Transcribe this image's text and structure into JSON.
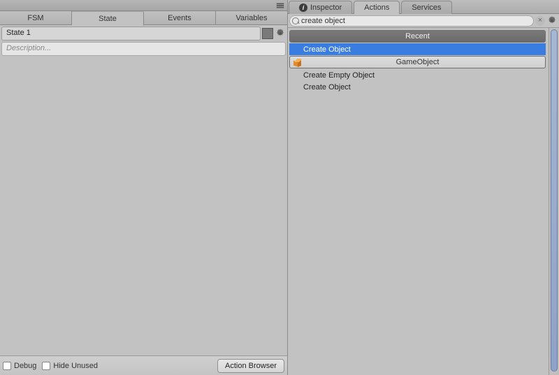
{
  "left": {
    "tabs": [
      "FSM",
      "State",
      "Events",
      "Variables"
    ],
    "active_tab_index": 1,
    "state_name": "State 1",
    "description_placeholder": "Description...",
    "footer": {
      "debug_label": "Debug",
      "hide_unused_label": "Hide Unused",
      "action_browser_label": "Action Browser"
    }
  },
  "right": {
    "tabs": [
      {
        "label": "Inspector",
        "has_info_icon": true
      },
      {
        "label": "Actions",
        "has_info_icon": false
      },
      {
        "label": "Services",
        "has_info_icon": false
      }
    ],
    "active_tab_index": 1,
    "search_value": "create object",
    "groups": [
      {
        "title": "Recent",
        "style": "recent",
        "icon": null,
        "items": [
          {
            "label": "Create Object",
            "selected": true
          }
        ]
      },
      {
        "title": "GameObject",
        "style": "gameobject",
        "icon": "cube-icon",
        "items": [
          {
            "label": "Create Empty Object",
            "selected": false
          },
          {
            "label": "Create Object",
            "selected": false
          }
        ]
      }
    ]
  },
  "colors": {
    "selection": "#3a7de0"
  }
}
